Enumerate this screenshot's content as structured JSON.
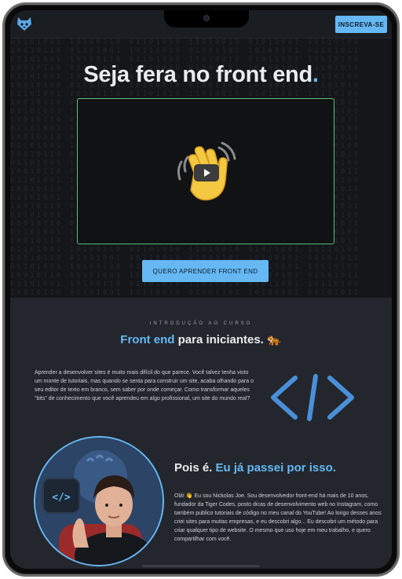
{
  "header": {
    "logo_icon": "tiger-logo-icon",
    "subscribe_label": "INSCREVA-SE"
  },
  "hero": {
    "title": "Seja fera no front end",
    "title_dot": ".",
    "video_icon": "waving-hand-icon",
    "play_icon": "play-icon",
    "cta_label": "QUERO APRENDER FRONT END"
  },
  "intro": {
    "overline": "INTRODUÇÃO AO CURSO",
    "title_highlight": "Front end",
    "title_rest": " para iniciantes.",
    "title_emoji": "🐅",
    "paragraph": "Aprender a desenvolver sites é muito mais difícil do que parece. Você talvez tenha visto um monte de tutoriais, mas quando se senta para construir um site, acaba olhando para o seu editor de texto em branco, sem saber por onde começar. Como transformar aqueles \"bits\" de conhecimento que você aprendeu em algo profissional, um site do mundo real?",
    "code_icon": "code-brackets-icon"
  },
  "about": {
    "title_plain": "Pois é. ",
    "title_highlight": "Eu já passei por isso.",
    "bio": "Olá! 👋 Eu sou Nickolas Joe. Sou desenvolvedor front-end há mais de 10 anos, fundador da Tiger Codes, posto dicas de desenvolvimento web no Instagram, como também publico tutoriais de código no meu canal do YouTube! Ao longo desses anos criei sites para muitas empresas, e eu descobri algo... Eu descobri um método para criar qualquer tipo de website. O mesmo que uso hoje em meu trabalho, e quero compartilhar com você.",
    "avatar_icon": "avatar-photo"
  },
  "colors": {
    "accent": "#65b8f3",
    "video_border": "#5fc07b",
    "hero_bg": "#14161a",
    "section_bg": "#23272d"
  }
}
